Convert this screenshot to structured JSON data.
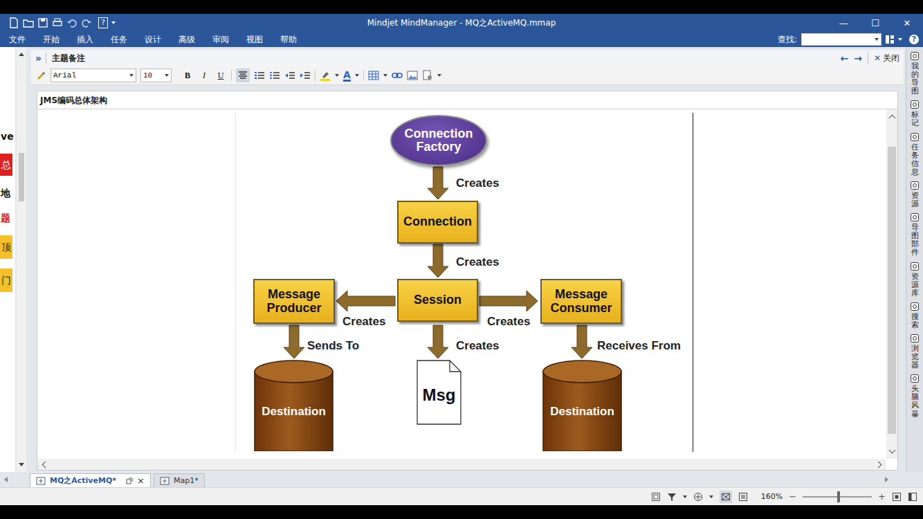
{
  "window": {
    "title": "Mindjet MindManager - MQ之ActiveMQ.mmap",
    "controls": [
      "—",
      "☐",
      "✕"
    ],
    "help": "?"
  },
  "menu": {
    "items": [
      "文件",
      "开始",
      "插入",
      "任务",
      "设计",
      "高级",
      "审阅",
      "视图",
      "帮助"
    ],
    "search_label": "查找:",
    "help": "?"
  },
  "left_fragments": [
    {
      "text": "ve",
      "kind": "plain"
    },
    {
      "text": "总",
      "kind": "red-block"
    },
    {
      "text": "地",
      "kind": "plain"
    },
    {
      "text": "题",
      "kind": "red-text"
    },
    {
      "text": "顶",
      "kind": "yellow-block"
    },
    {
      "text": "门",
      "kind": "yellow-block"
    }
  ],
  "notes": {
    "collapse": "»",
    "title": "主题备注",
    "back": "←",
    "forward": "→",
    "close_glyph": "✕",
    "close_label": "关闭",
    "toolbar": {
      "font": "Arial",
      "size": "10",
      "bold": "B",
      "italic": "I",
      "underline": "U",
      "font_color": "A"
    },
    "topic_title": "JMS编码总体架构"
  },
  "diagram": {
    "nodes": [
      {
        "label": "Connection Factory",
        "kind": "ellipse"
      },
      {
        "label": "Connection",
        "kind": "box"
      },
      {
        "label": "Session",
        "kind": "box"
      },
      {
        "label": "Message Producer",
        "kind": "box"
      },
      {
        "label": "Message Consumer",
        "kind": "box"
      },
      {
        "label": "Destination",
        "kind": "cylinder"
      },
      {
        "label": "Msg",
        "kind": "document"
      },
      {
        "label": "Destination",
        "kind": "cylinder"
      }
    ],
    "edges": [
      {
        "label": "Creates"
      },
      {
        "label": "Creates"
      },
      {
        "label": "Creates"
      },
      {
        "label": "Creates"
      },
      {
        "label": "Sends To"
      },
      {
        "label": "Creates"
      },
      {
        "label": "Receives From"
      }
    ]
  },
  "sidebar": {
    "items": [
      "我的导图",
      "标记",
      "任务信息",
      "资源",
      "导图部件",
      "资源库",
      "搜索",
      "浏览器",
      "头脑风暴"
    ]
  },
  "doc_tabs": [
    {
      "label": "MQ之ActiveMQ*",
      "selected": true,
      "close": "×"
    },
    {
      "label": "Map1*",
      "selected": false
    }
  ],
  "status_bar": {
    "zoom": "160%",
    "zoom_out": "−",
    "zoom_in": "+",
    "level": 0.52
  }
}
